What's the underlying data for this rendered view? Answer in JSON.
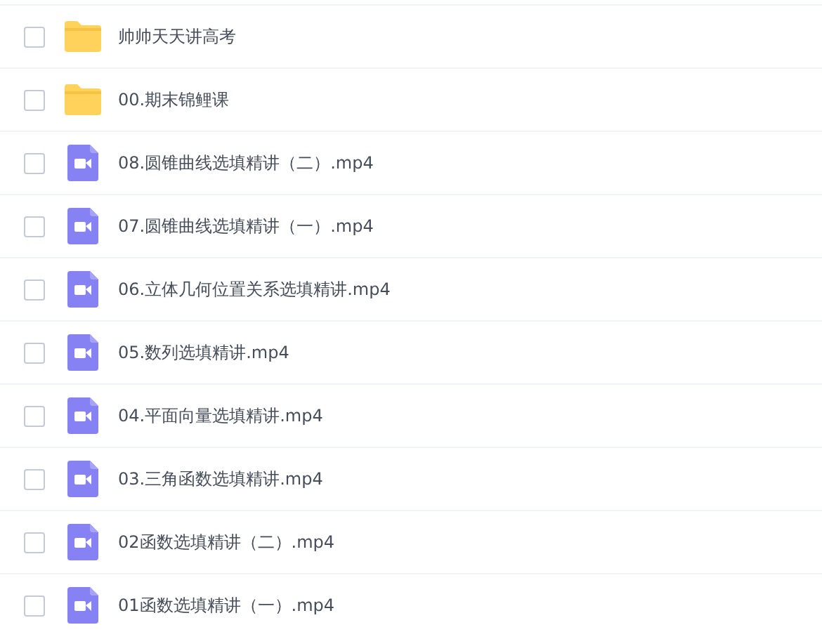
{
  "files": [
    {
      "kind": "folder",
      "name": "帅帅天天讲高考",
      "checked": false
    },
    {
      "kind": "folder",
      "name": "00.期末锦鲤课",
      "checked": false
    },
    {
      "kind": "video",
      "name": "08.圆锥曲线选填精讲（二）.mp4",
      "checked": false
    },
    {
      "kind": "video",
      "name": "07.圆锥曲线选填精讲（一）.mp4",
      "checked": false
    },
    {
      "kind": "video",
      "name": "06.立体几何位置关系选填精讲.mp4",
      "checked": false
    },
    {
      "kind": "video",
      "name": "05.数列选填精讲.mp4",
      "checked": false
    },
    {
      "kind": "video",
      "name": "04.平面向量选填精讲.mp4",
      "checked": false
    },
    {
      "kind": "video",
      "name": "03.三角函数选填精讲.mp4",
      "checked": false
    },
    {
      "kind": "video",
      "name": "02函数选填精讲（二）.mp4",
      "checked": false
    },
    {
      "kind": "video",
      "name": "01函数选填精讲（一）.mp4",
      "checked": false
    }
  ]
}
